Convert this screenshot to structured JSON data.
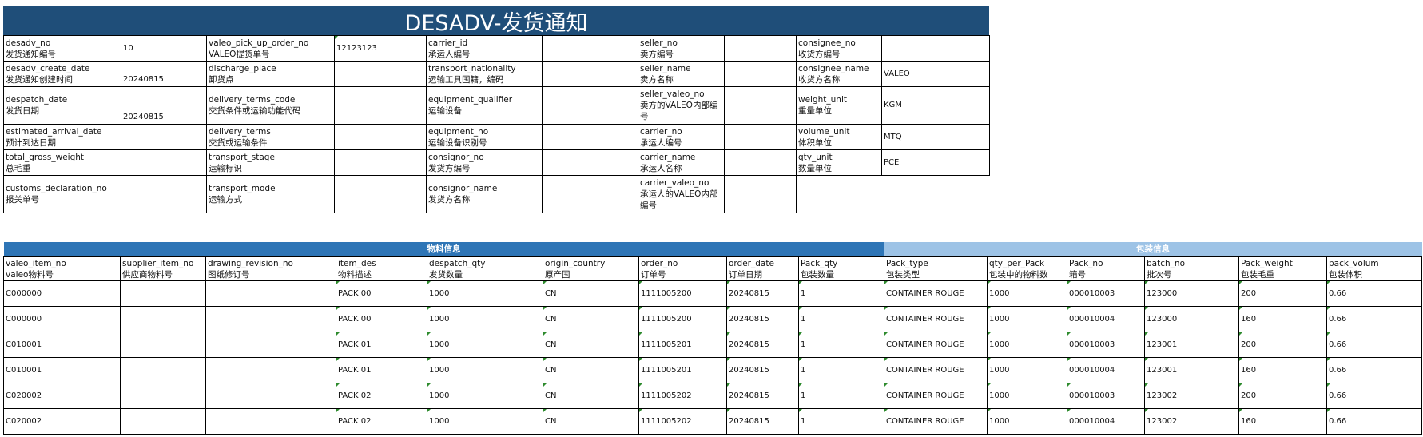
{
  "title": "DESADV-发货通知",
  "header_rows": [
    [
      {
        "en": "desadv_no",
        "cn": "发货通知编号",
        "val": "10"
      },
      {
        "en": "valeo_pick_up_order_no",
        "cn": "VALEO提货单号",
        "val": "12123123"
      },
      {
        "en": "carrier_id",
        "cn": "承运人编号",
        "val": ""
      },
      {
        "en": "seller_no",
        "cn": "卖方编号",
        "val": ""
      },
      {
        "en": "consignee_no",
        "cn": "收货方编号",
        "val": ""
      }
    ],
    [
      {
        "en": "desadv_create_date",
        "cn": "发货通知创建时间",
        "val": "20240815"
      },
      {
        "en": "discharge_place",
        "cn": "卸货点",
        "val": ""
      },
      {
        "en": "transport_nationality",
        "cn": "运输工具国籍，编码",
        "val": ""
      },
      {
        "en": "seller_name",
        "cn": "卖方名称",
        "val": ""
      },
      {
        "en": "consignee_name",
        "cn": "收货方名称",
        "val": "VALEO"
      }
    ],
    [
      {
        "en": "despatch_date",
        "cn": "发货日期",
        "val": "20240815"
      },
      {
        "en": "delivery_terms_code",
        "cn": "交货条件或运输功能代码",
        "val": ""
      },
      {
        "en": "equipment_qualifier",
        "cn": "运输设备",
        "val": ""
      },
      {
        "en": "seller_valeo_no",
        "cn": "卖方的VALEO内部编号",
        "val": ""
      },
      {
        "en": "weight_unit",
        "cn": "重量单位",
        "val": "KGM"
      }
    ],
    [
      {
        "en": "estimated_arrival_date",
        "cn": "预计到达日期",
        "val": ""
      },
      {
        "en": "delivery_terms",
        "cn": "交货或运输条件",
        "val": ""
      },
      {
        "en": "equipment_no",
        "cn": "运输设备识别号",
        "val": ""
      },
      {
        "en": "carrier_no",
        "cn": "承运人编号",
        "val": ""
      },
      {
        "en": "volume_unit",
        "cn": "体积单位",
        "val": "MTQ"
      }
    ],
    [
      {
        "en": "total_gross_weight",
        "cn": "总毛重",
        "val": ""
      },
      {
        "en": "transport_stage",
        "cn": "运输标识",
        "val": ""
      },
      {
        "en": "consignor_no",
        "cn": "发货方编号",
        "val": ""
      },
      {
        "en": "carrier_name",
        "cn": "承运人名称",
        "val": ""
      },
      {
        "en": "qty_unit",
        "cn": "数量单位",
        "val": "PCE"
      }
    ],
    [
      {
        "en": "customs_declaration_no",
        "cn": "报关单号",
        "val": ""
      },
      {
        "en": "transport_mode",
        "cn": "运输方式",
        "val": ""
      },
      {
        "en": "consignor_name",
        "cn": "发货方名称",
        "val": ""
      },
      {
        "en": "carrier_valeo_no",
        "cn": "承运人的VALEO内部编号",
        "val": ""
      }
    ]
  ],
  "sections": {
    "material": "物料信息",
    "packing": "包装信息"
  },
  "columns": [
    {
      "en": "valeo_item_no",
      "cn": "valeo物料号"
    },
    {
      "en": "supplier_item_no",
      "cn": "供应商物料号"
    },
    {
      "en": "drawing_revision_no",
      "cn": "图纸修订号"
    },
    {
      "en": "item_des",
      "cn": "物料描述"
    },
    {
      "en": "despatch_qty",
      "cn": "发货数量"
    },
    {
      "en": "origin_country",
      "cn": "原产国"
    },
    {
      "en": "order_no",
      "cn": "订单号"
    },
    {
      "en": "order_date",
      "cn": "订单日期"
    },
    {
      "en": "Pack_qty",
      "cn": "包装数量"
    },
    {
      "en": "Pack_type",
      "cn": "包装类型"
    },
    {
      "en": "qty_per_Pack",
      "cn": "包装中的物料数"
    },
    {
      "en": "Pack_no",
      "cn": "箱号"
    },
    {
      "en": "batch_no",
      "cn": "批次号"
    },
    {
      "en": "Pack_weight",
      "cn": "包装毛重"
    },
    {
      "en": "pack_volum",
      "cn": "包装体积"
    }
  ],
  "rows": [
    [
      "C000000",
      "",
      "",
      "PACK 00",
      "1000",
      "CN",
      "1111005200",
      "20240815",
      "1",
      "CONTAINER ROUGE",
      "1000",
      "000010003",
      "123000",
      "200",
      "0.66"
    ],
    [
      "C000000",
      "",
      "",
      "PACK 00",
      "1000",
      "CN",
      "1111005200",
      "20240815",
      "1",
      "CONTAINER ROUGE",
      "1000",
      "000010004",
      "123000",
      "160",
      "0.66"
    ],
    [
      "C010001",
      "",
      "",
      "PACK 01",
      "1000",
      "CN",
      "1111005201",
      "20240815",
      "1",
      "CONTAINER ROUGE",
      "1000",
      "000010003",
      "123001",
      "200",
      "0.66"
    ],
    [
      "C010001",
      "",
      "",
      "PACK 01",
      "1000",
      "CN",
      "1111005201",
      "20240815",
      "1",
      "CONTAINER ROUGE",
      "1000",
      "000010004",
      "123001",
      "160",
      "0.66"
    ],
    [
      "C020002",
      "",
      "",
      "PACK 02",
      "1000",
      "CN",
      "1111005202",
      "20240815",
      "1",
      "CONTAINER ROUGE",
      "1000",
      "000010003",
      "123002",
      "200",
      "0.66"
    ],
    [
      "C020002",
      "",
      "",
      "PACK 02",
      "1000",
      "CN",
      "1111005202",
      "20240815",
      "1",
      "CONTAINER ROUGE",
      "1000",
      "000010004",
      "123002",
      "160",
      "0.66"
    ]
  ]
}
